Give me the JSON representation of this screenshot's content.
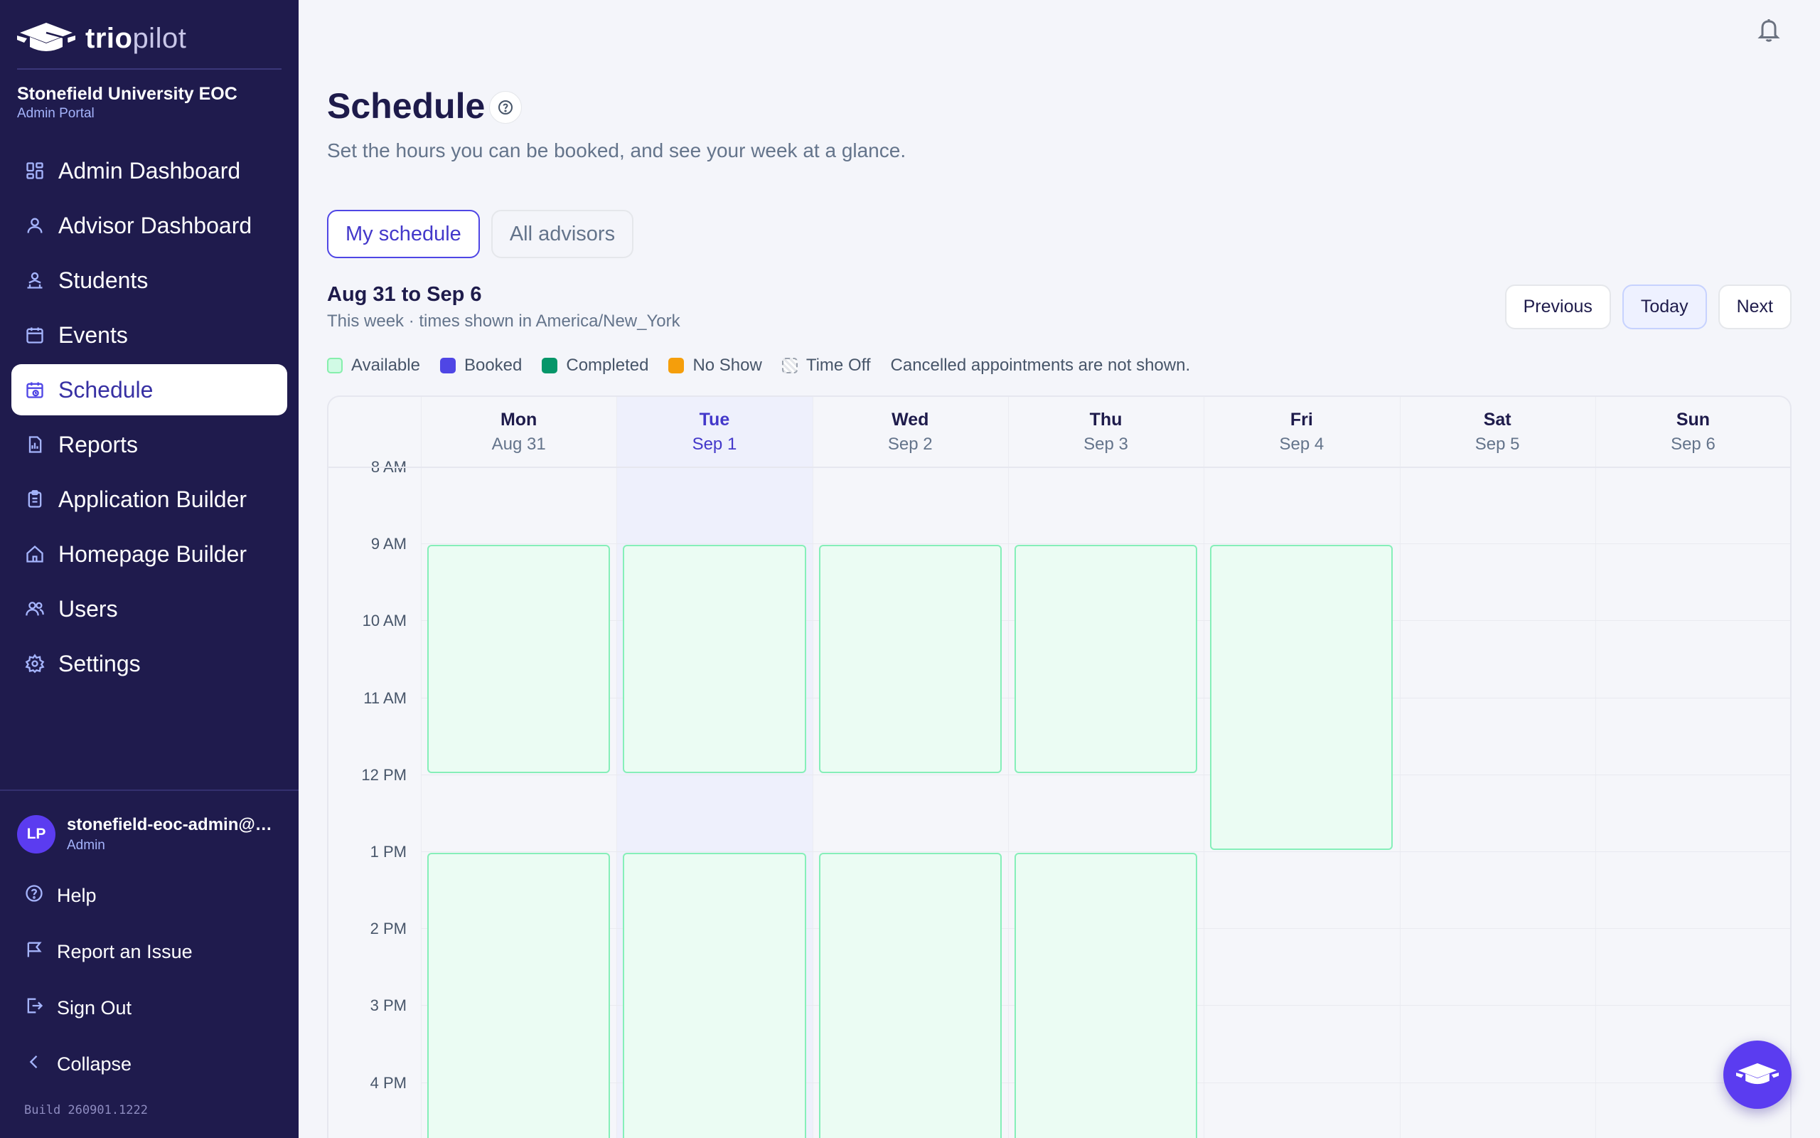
{
  "brand": {
    "part1": "trio",
    "part2": "pilot"
  },
  "org": {
    "name": "Stonefield University EOC",
    "role": "Admin Portal"
  },
  "nav": [
    {
      "label": "Admin Dashboard",
      "icon": "dashboard-icon"
    },
    {
      "label": "Advisor Dashboard",
      "icon": "user-icon"
    },
    {
      "label": "Students",
      "icon": "students-icon"
    },
    {
      "label": "Events",
      "icon": "calendar-icon"
    },
    {
      "label": "Schedule",
      "icon": "schedule-icon",
      "active": true
    },
    {
      "label": "Reports",
      "icon": "report-icon"
    },
    {
      "label": "Application Builder",
      "icon": "clipboard-icon"
    },
    {
      "label": "Homepage Builder",
      "icon": "home-icon"
    },
    {
      "label": "Users",
      "icon": "users-icon"
    },
    {
      "label": "Settings",
      "icon": "gear-icon"
    }
  ],
  "user": {
    "initials": "LP",
    "email": "stonefield-eoc-admin@de...",
    "role": "Admin"
  },
  "footer_nav": [
    {
      "label": "Help",
      "icon": "help-icon"
    },
    {
      "label": "Report an Issue",
      "icon": "flag-icon"
    },
    {
      "label": "Sign Out",
      "icon": "sign-out-icon"
    },
    {
      "label": "Collapse",
      "icon": "chevron-left-icon"
    }
  ],
  "build": "Build 260901.1222",
  "page": {
    "title": "Schedule",
    "subtitle": "Set the hours you can be booked, and see your week at a glance."
  },
  "tabs": [
    {
      "label": "My schedule",
      "active": true
    },
    {
      "label": "All advisors",
      "active": false
    }
  ],
  "week": {
    "title": "Aug 31 to Sep 6",
    "subtitle": "This week · times shown in America/New_York",
    "previous_label": "Previous",
    "today_label": "Today",
    "next_label": "Next"
  },
  "legend": {
    "items": [
      {
        "label": "Available",
        "color": "#d1fae5",
        "border": "#86efac"
      },
      {
        "label": "Booked",
        "color": "#4f46e5",
        "border": "#4f46e5"
      },
      {
        "label": "Completed",
        "color": "#059669",
        "border": "#059669"
      },
      {
        "label": "No Show",
        "color": "#f59e0b",
        "border": "#f59e0b"
      },
      {
        "label": "Time Off",
        "color": "#e5e7eb",
        "border": "#9ca3af"
      }
    ],
    "note": "Cancelled appointments are not shown."
  },
  "calendar": {
    "days": [
      {
        "name": "Mon",
        "date": "Aug 31"
      },
      {
        "name": "Tue",
        "date": "Sep 1",
        "today": true
      },
      {
        "name": "Wed",
        "date": "Sep 2"
      },
      {
        "name": "Thu",
        "date": "Sep 3"
      },
      {
        "name": "Fri",
        "date": "Sep 4"
      },
      {
        "name": "Sat",
        "date": "Sep 5"
      },
      {
        "name": "Sun",
        "date": "Sep 6"
      }
    ],
    "hours": [
      "8 AM",
      "9 AM",
      "10 AM",
      "11 AM",
      "12 PM",
      "1 PM",
      "2 PM",
      "3 PM",
      "4 PM"
    ],
    "first_hour": 8,
    "availability": [
      {
        "day": 0,
        "start": 9,
        "end": 12
      },
      {
        "day": 1,
        "start": 9,
        "end": 12
      },
      {
        "day": 2,
        "start": 9,
        "end": 12
      },
      {
        "day": 3,
        "start": 9,
        "end": 12
      },
      {
        "day": 4,
        "start": 9,
        "end": 13
      },
      {
        "day": 0,
        "start": 13,
        "end": 17
      },
      {
        "day": 1,
        "start": 13,
        "end": 17
      },
      {
        "day": 2,
        "start": 13,
        "end": 17
      },
      {
        "day": 3,
        "start": 13,
        "end": 17
      }
    ],
    "status": "available",
    "today_band_color": "#eef0fc"
  }
}
